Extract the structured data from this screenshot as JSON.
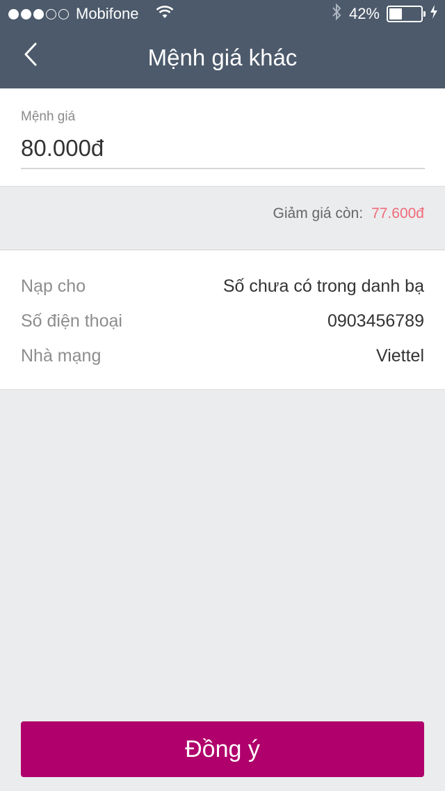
{
  "status_bar": {
    "carrier": "Mobifone",
    "signal_bars_filled": 3,
    "signal_bars_total": 5,
    "battery_percent": "42%",
    "battery_level": 0.42
  },
  "nav": {
    "title": "Mệnh giá khác",
    "back_icon": "chevron-left-icon"
  },
  "amount": {
    "label": "Mệnh giá",
    "value": "80.000đ"
  },
  "discount": {
    "label": "Giảm giá còn:",
    "value": "77.600đ"
  },
  "info": {
    "rows": [
      {
        "label": "Nạp cho",
        "value": "Số chưa có trong danh bạ"
      },
      {
        "label": "Số điện thoại",
        "value": "0903456789"
      },
      {
        "label": "Nhà mạng",
        "value": "Viettel"
      }
    ]
  },
  "confirm_button": {
    "label": "Đồng ý"
  },
  "colors": {
    "header": "#4c5a6b",
    "accent": "#b0006b",
    "discount": "#f06a7a",
    "background": "#ebeced"
  }
}
